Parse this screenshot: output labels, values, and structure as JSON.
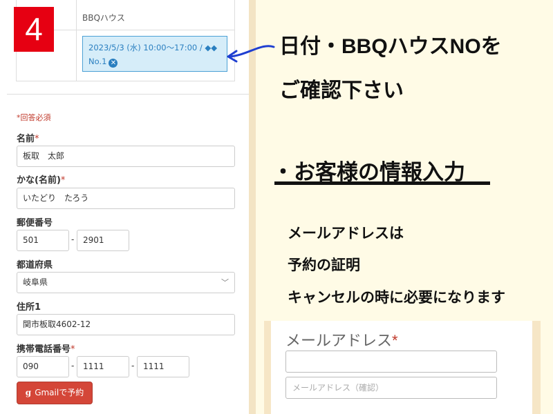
{
  "step_badge": "4",
  "reservation": {
    "house_label": "BBQハウス",
    "selected_line1": "2023/5/3 (水) 10:00～17:00 / ◆◆",
    "selected_line2": "No.1"
  },
  "form": {
    "required_note": "*回答必須",
    "name_label": "名前",
    "name_value": "板取　太郎",
    "kana_label": "かな(名前)",
    "kana_value": "いたどり　たろう",
    "postal_label": "郵便番号",
    "postal1": "501",
    "postal2": "2901",
    "pref_label": "都道府県",
    "pref_value": "岐阜県",
    "address_label": "住所1",
    "address_value": "関市板取4602-12",
    "phone_label": "携帯電話番号",
    "phone1": "090",
    "phone2": "1111",
    "phone3": "1111",
    "dash": "-",
    "required_star": "*",
    "gmail_button": "Gmailで予約",
    "gmail_icon": "g"
  },
  "instructions": {
    "line1": "日付・BBQハウスNOを",
    "line2": "ご確認下さい",
    "heading": "・お客様の情報入力",
    "note1": "メールアドレスは",
    "note2": "予約の証明",
    "note3": "キャンセルの時に必要になります"
  },
  "email": {
    "label": "メールアドレス",
    "required_star": "*",
    "input_value": "",
    "confirm_placeholder": "メールアドレス（確認）"
  },
  "colors": {
    "badge": "#e60012",
    "selection_bg": "#d6edf9",
    "selection_text": "#2a7fc0",
    "required": "#c0392b",
    "gmail_button": "#d44638",
    "arrow": "#1f3fd1",
    "panel_bg": "#fffbe6"
  }
}
